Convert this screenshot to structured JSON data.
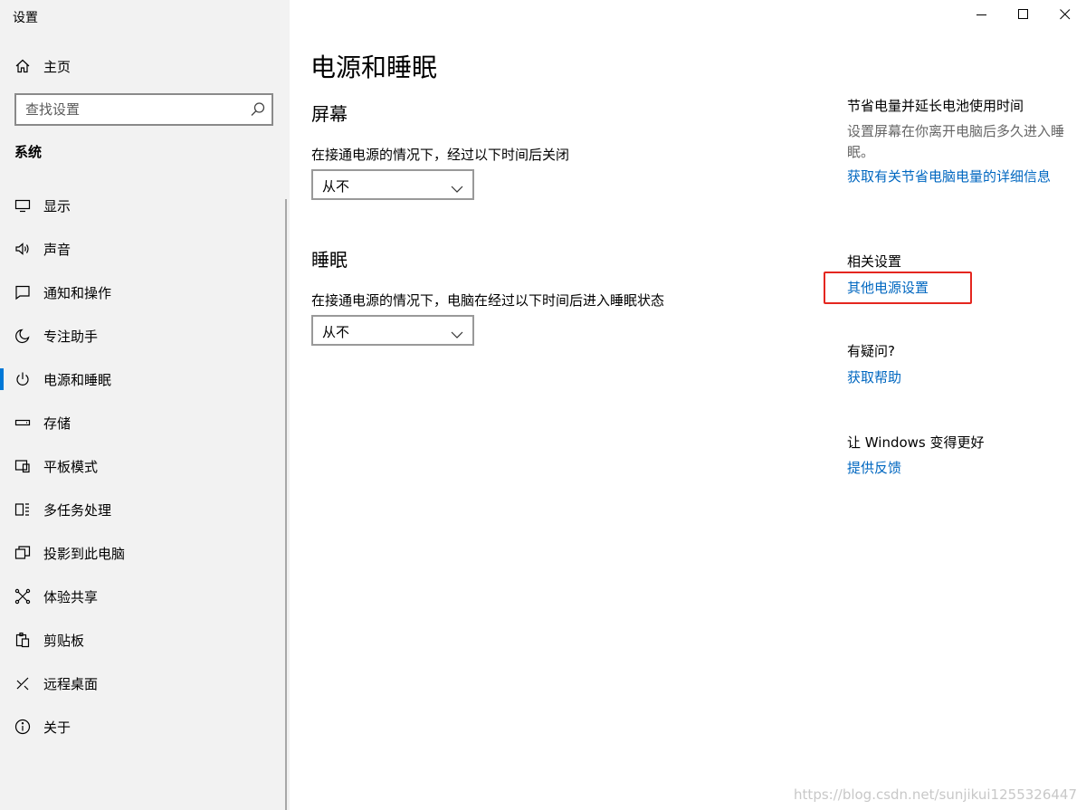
{
  "window": {
    "title": "设置"
  },
  "sidebar": {
    "home_label": "主页",
    "search_placeholder": "查找设置",
    "section_label": "系统",
    "items": [
      {
        "label": "显示",
        "icon": "monitor-icon",
        "selected": false
      },
      {
        "label": "声音",
        "icon": "speaker-icon",
        "selected": false
      },
      {
        "label": "通知和操作",
        "icon": "notification-icon",
        "selected": false
      },
      {
        "label": "专注助手",
        "icon": "moon-icon",
        "selected": false
      },
      {
        "label": "电源和睡眠",
        "icon": "power-icon",
        "selected": true
      },
      {
        "label": "存储",
        "icon": "storage-icon",
        "selected": false
      },
      {
        "label": "平板模式",
        "icon": "tablet-icon",
        "selected": false
      },
      {
        "label": "多任务处理",
        "icon": "multitask-icon",
        "selected": false
      },
      {
        "label": "投影到此电脑",
        "icon": "project-icon",
        "selected": false
      },
      {
        "label": "体验共享",
        "icon": "share-icon",
        "selected": false
      },
      {
        "label": "剪贴板",
        "icon": "clipboard-icon",
        "selected": false
      },
      {
        "label": "远程桌面",
        "icon": "remote-desktop-icon",
        "selected": false
      },
      {
        "label": "关于",
        "icon": "info-icon",
        "selected": false
      }
    ]
  },
  "main": {
    "title": "电源和睡眠",
    "screen": {
      "title": "屏幕",
      "desc": "在接通电源的情况下，经过以下时间后关闭",
      "value": "从不"
    },
    "sleep": {
      "title": "睡眠",
      "desc": "在接通电源的情况下，电脑在经过以下时间后进入睡眠状态",
      "value": "从不"
    }
  },
  "right": {
    "save_power": {
      "heading": "节省电量并延长电池使用时间",
      "text": "设置屏幕在你离开电脑后多久进入睡眠。",
      "link": "获取有关节省电脑电量的详细信息"
    },
    "related": {
      "heading": "相关设置",
      "link": "其他电源设置"
    },
    "question": {
      "heading": "有疑问?",
      "link": "获取帮助"
    },
    "feedback": {
      "heading": "让 Windows 变得更好",
      "link": "提供反馈"
    }
  },
  "watermark": "https://blog.csdn.net/sunjikui1255326447",
  "colors": {
    "accent": "#0078d7",
    "link": "#0067c0",
    "highlight": "#e4261f",
    "sidebar_bg": "#f2f2f2"
  }
}
